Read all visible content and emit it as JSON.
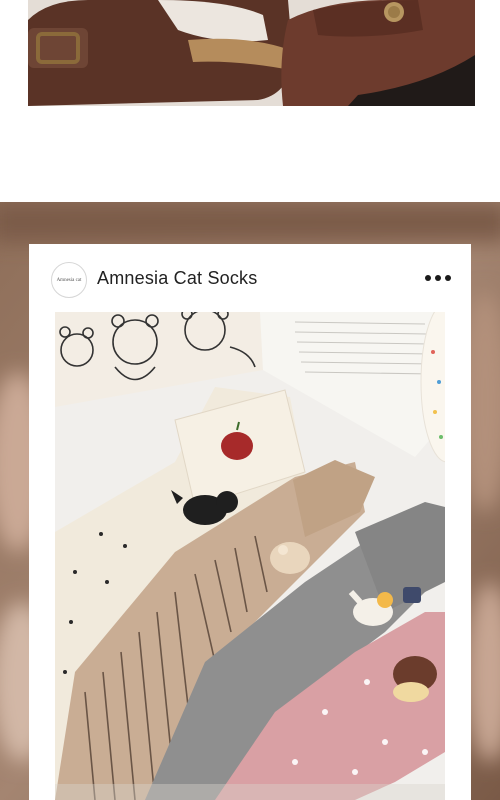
{
  "post": {
    "account_name": "Amnesia Cat Socks",
    "avatar_text": "Amnesia cat"
  },
  "icons": {
    "more": "more-horizontal-icon"
  },
  "colors": {
    "background_brown": "#8a6a55",
    "sock_cream": "#efe7d8",
    "sock_beige": "#c9ad94",
    "sock_gray": "#8f8f8f",
    "sock_pink": "#d9a0a4"
  }
}
